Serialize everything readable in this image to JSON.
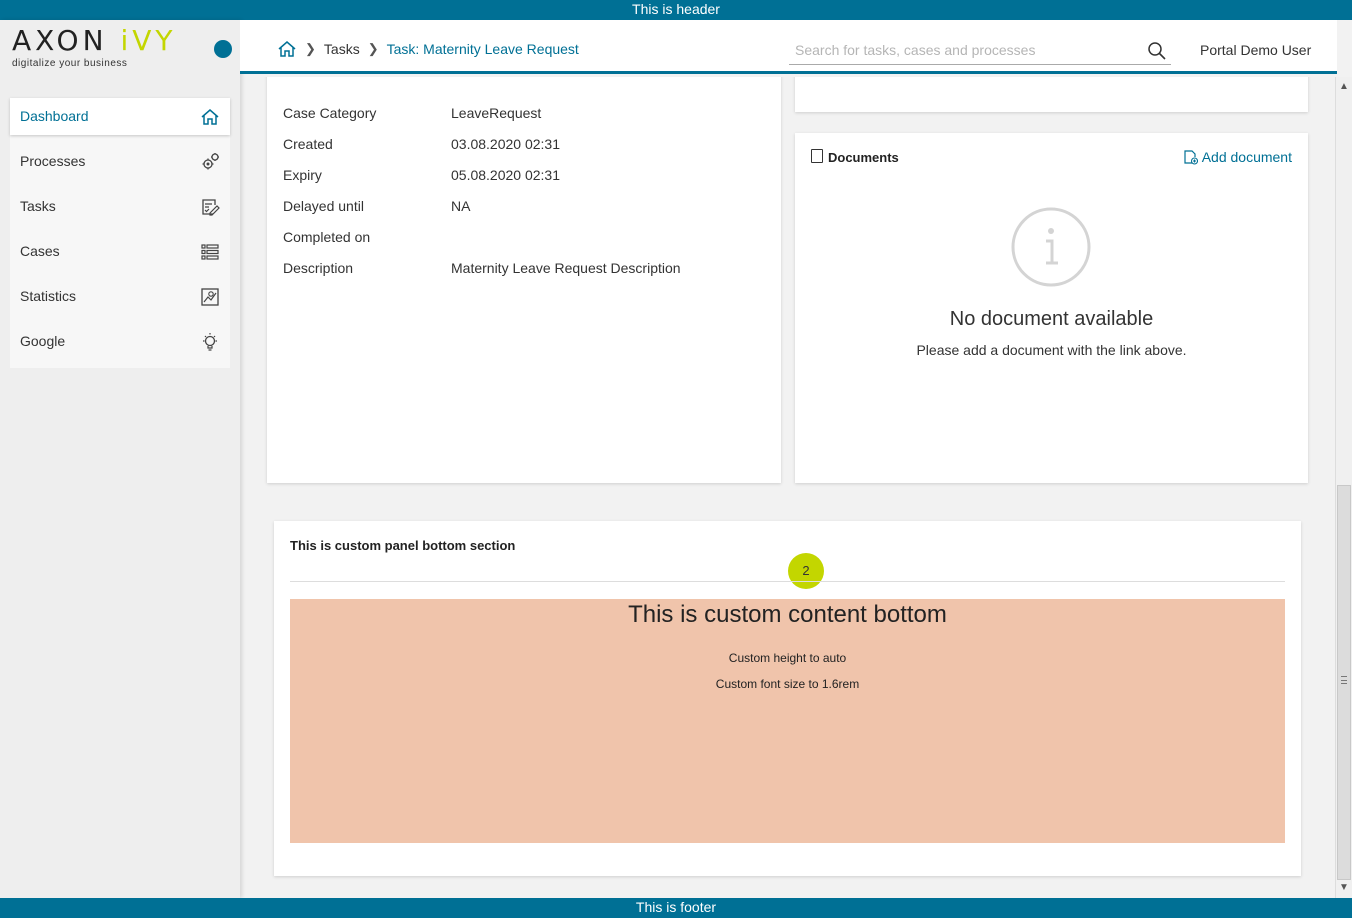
{
  "header_strip": "This is header",
  "footer_strip": "This is footer",
  "brand": {
    "main": "AXON ",
    "accent": "iVY",
    "tagline": "digitalize your business",
    "accent_color": "#c3d600",
    "primary_color": "#007095"
  },
  "sidebar": {
    "items": [
      {
        "label": "Dashboard",
        "icon": "home-icon"
      },
      {
        "label": "Processes",
        "icon": "gears-icon"
      },
      {
        "label": "Tasks",
        "icon": "task-edit-icon"
      },
      {
        "label": "Cases",
        "icon": "list-icon"
      },
      {
        "label": "Statistics",
        "icon": "chart-icon"
      },
      {
        "label": "Google",
        "icon": "lightbulb-icon"
      }
    ]
  },
  "breadcrumb": {
    "home_icon": "home-icon",
    "tasks": "Tasks",
    "current": "Task: Maternity Leave Request"
  },
  "search": {
    "placeholder": "Search for tasks, cases and processes",
    "value": ""
  },
  "user": {
    "name": "Portal Demo User"
  },
  "task_details": {
    "rows": [
      {
        "label": "Case Category",
        "value": "LeaveRequest"
      },
      {
        "label": "Created",
        "value": "03.08.2020 02:31"
      },
      {
        "label": "Expiry",
        "value": "05.08.2020 02:31"
      },
      {
        "label": "Delayed until",
        "value": "NA"
      },
      {
        "label": "Completed on",
        "value": ""
      },
      {
        "label": "Description",
        "value": "Maternity Leave Request Description"
      }
    ]
  },
  "documents": {
    "title": "Documents",
    "add_label": "Add document",
    "empty_title": "No document available",
    "empty_sub": "Please add a document with the link above."
  },
  "custom_panel": {
    "title": "This is custom panel bottom section",
    "badge": "2",
    "content_title": "This is custom content bottom",
    "line1": "Custom height to auto",
    "line2": "Custom font size to 1.6rem",
    "content_color": "#f0c4ab"
  }
}
